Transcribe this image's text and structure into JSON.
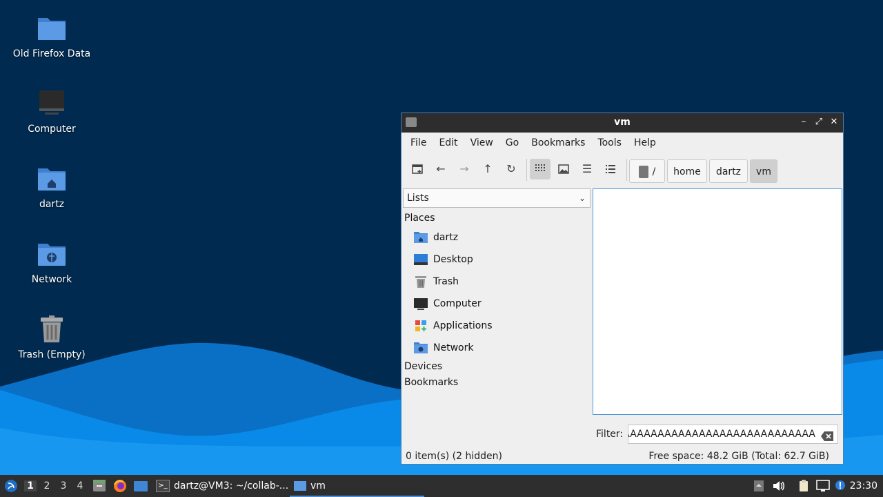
{
  "desktop_icons": [
    {
      "label": "Old Firefox Data",
      "icon": "folder-icon"
    },
    {
      "label": "Computer",
      "icon": "computer-icon"
    },
    {
      "label": "dartz",
      "icon": "home-folder-icon"
    },
    {
      "label": "Network",
      "icon": "network-folder-icon"
    },
    {
      "label": "Trash (Empty)",
      "icon": "trash-icon"
    }
  ],
  "window": {
    "title": "vm",
    "menu": [
      "File",
      "Edit",
      "View",
      "Go",
      "Bookmarks",
      "Tools",
      "Help"
    ],
    "breadcrumbs": [
      "/",
      "home",
      "dartz",
      "vm"
    ],
    "side_panel_mode": "Lists",
    "sections": {
      "places": "Places",
      "devices": "Devices",
      "bookmarks": "Bookmarks"
    },
    "places": [
      {
        "label": "dartz",
        "icon": "home-folder-icon"
      },
      {
        "label": "Desktop",
        "icon": "desktop-icon"
      },
      {
        "label": "Trash",
        "icon": "trash-icon"
      },
      {
        "label": "Computer",
        "icon": "computer-icon"
      },
      {
        "label": "Applications",
        "icon": "applications-icon"
      },
      {
        "label": "Network",
        "icon": "network-folder-icon"
      }
    ],
    "filter_label": "Filter:",
    "filter_value": "AAAAAAAAAAAAAAAAAAAAAAAAAAAAAAAAAAAAAAAAAAAAAA",
    "status_left": "0 item(s) (2 hidden)",
    "status_right": "Free space: 48.2 GiB (Total: 62.7 GiB)"
  },
  "taskbar": {
    "workspaces": [
      "1",
      "2",
      "3",
      "4"
    ],
    "tasks": [
      {
        "label": "dartz@VM3: ~/collab-...",
        "icon": "terminal-icon"
      },
      {
        "label": "vm",
        "icon": "folder-icon"
      }
    ],
    "clock": "23:30"
  },
  "colors": {
    "accent": "#4c98d8",
    "desktop_bg": "#002a50",
    "wave": "#0a8ae8",
    "folder": "#5b9be6"
  }
}
